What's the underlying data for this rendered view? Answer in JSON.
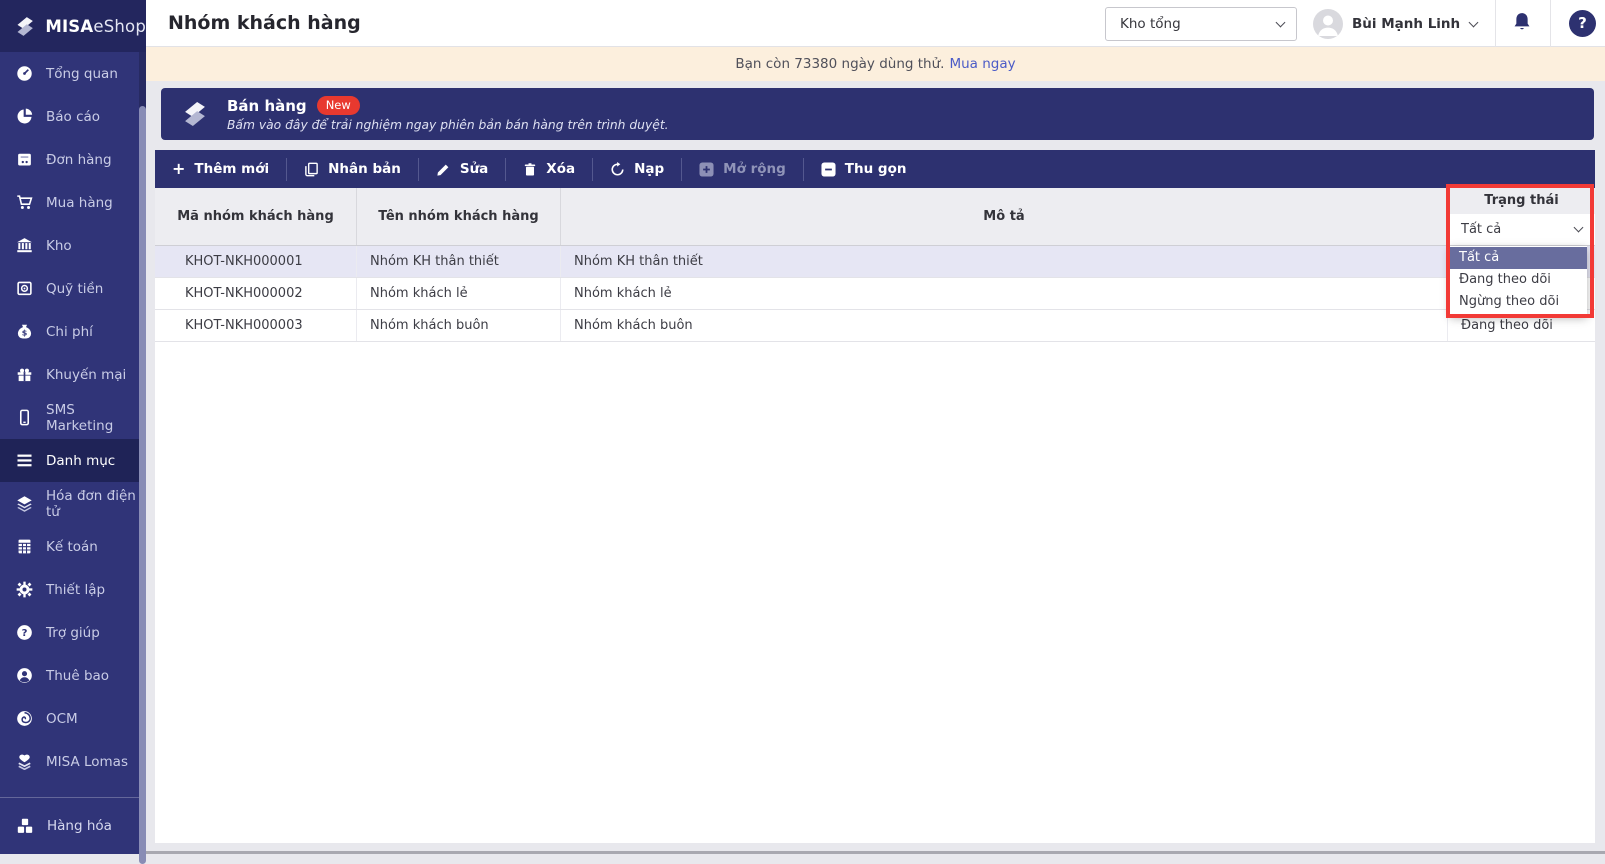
{
  "app": {
    "brand_bold": "MISA",
    "brand_light": "eShop"
  },
  "sidebar": {
    "items": [
      {
        "label": "Tổng quan",
        "icon": "gauge-icon"
      },
      {
        "label": "Báo cáo",
        "icon": "pie-chart-icon"
      },
      {
        "label": "Đơn hàng",
        "icon": "order-icon"
      },
      {
        "label": "Mua hàng",
        "icon": "cart-icon"
      },
      {
        "label": "Kho",
        "icon": "bank-icon"
      },
      {
        "label": "Quỹ tiền",
        "icon": "safe-icon"
      },
      {
        "label": "Chi phí",
        "icon": "money-bag-icon"
      },
      {
        "label": "Khuyến mại",
        "icon": "gift-icon"
      },
      {
        "label": "SMS Marketing",
        "icon": "phone-icon"
      },
      {
        "label": "Danh mục",
        "icon": "list-icon",
        "active": true
      },
      {
        "label": "Hóa đơn điện tử",
        "icon": "layers-icon"
      },
      {
        "label": "Kế toán",
        "icon": "calculator-icon"
      },
      {
        "label": "Thiết lập",
        "icon": "gear-icon"
      },
      {
        "label": "Trợ giúp",
        "icon": "help-icon"
      },
      {
        "label": "Thuê bao",
        "icon": "user-icon"
      },
      {
        "label": "OCM",
        "icon": "spiral-icon"
      },
      {
        "label": "MISA Lomas",
        "icon": "lomas-icon"
      }
    ],
    "pinned_item": {
      "label": "Hàng hóa",
      "icon": "goods-icon"
    }
  },
  "header": {
    "title": "Nhóm khách hàng",
    "store_selector": "Kho tổng",
    "user_name": "Bùi Mạnh Linh",
    "help_label": "?"
  },
  "trial_bar": {
    "message": "Bạn còn 73380 ngày dùng thử.",
    "link": "Mua ngay"
  },
  "promo_banner": {
    "title": "Bán hàng",
    "badge": "New",
    "subtitle": "Bấm vào đây để trải nghiệm ngay phiên bản bán hàng trên trình duyệt."
  },
  "toolbar": {
    "add": "Thêm mới",
    "duplicate": "Nhân bản",
    "edit": "Sửa",
    "delete": "Xóa",
    "reload": "Nạp",
    "expand": "Mở rộng",
    "collapse": "Thu gọn",
    "plus_glyph": "+"
  },
  "table": {
    "columns": [
      "Mã nhóm khách hàng",
      "Tên nhóm khách hàng",
      "Mô tả",
      "Trạng thái"
    ],
    "status_filter": {
      "value": "Tất cả",
      "options": [
        "Tất cả",
        "Đang theo dõi",
        "Ngừng theo dõi"
      ],
      "selected_option": "Tất cả"
    },
    "rows": [
      {
        "code": "KHOT-NKH000001",
        "name": "Nhóm KH thân thiết",
        "description": "Nhóm KH thân thiết",
        "status": ""
      },
      {
        "code": "KHOT-NKH000002",
        "name": "Nhóm khách lẻ",
        "description": "Nhóm khách lẻ",
        "status": ""
      },
      {
        "code": "KHOT-NKH000003",
        "name": "Nhóm khách buôn",
        "description": "Nhóm khách buôn",
        "status": "Đang theo dõi"
      }
    ]
  },
  "colors": {
    "sidebar": "#303478",
    "navy": "#2d3170",
    "active_item": "#1f2357",
    "trial_bg": "#fcefdd",
    "link": "#4b5bc7",
    "badge_red": "#e8392f",
    "annotation_red": "#f23a36",
    "selected_row": "#e6e6f4",
    "dropdown_selected": "#686d9e",
    "header_bg": "#ededf1"
  }
}
